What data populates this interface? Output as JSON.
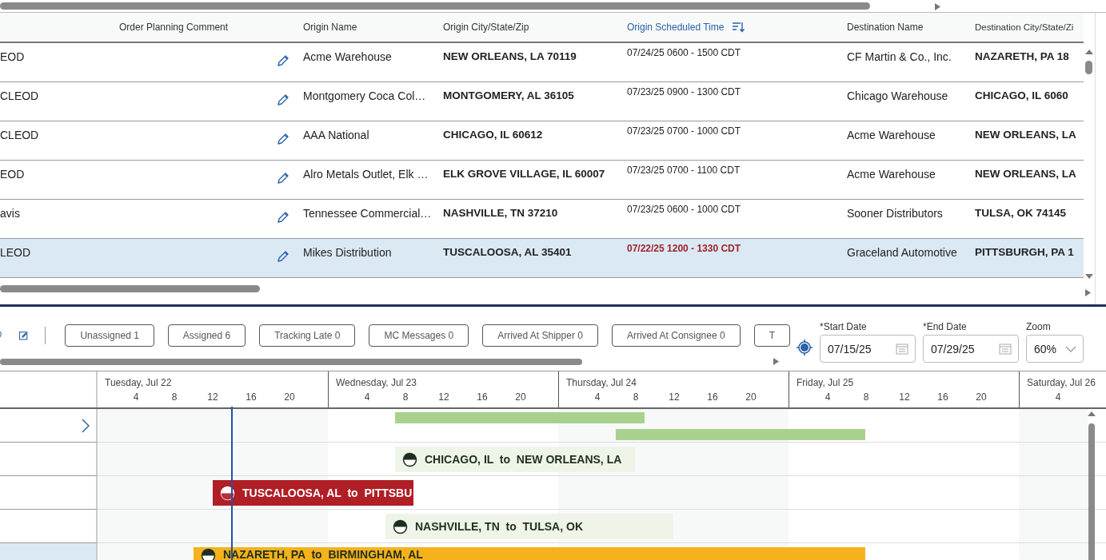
{
  "table": {
    "columns": [
      {
        "label": "Order Planning Comment",
        "sorted": false
      },
      {
        "label": "Origin Name",
        "sorted": false
      },
      {
        "label": "Origin City/State/Zip",
        "sorted": false
      },
      {
        "label": "Origin Scheduled Time",
        "sorted": true
      },
      {
        "label": "Destination Name",
        "sorted": false
      },
      {
        "label": "Destination City/State/Zi",
        "sorted": false
      }
    ],
    "rows": [
      {
        "column_1": "EOD",
        "origin_name": "Acme Warehouse",
        "origin_city": "NEW ORLEANS, LA 70119",
        "origin_time": "07/24/25 0600 - 1500 CDT",
        "late": false,
        "destination_name": "CF Martin & Co., Inc.",
        "destination_city": "NAZARETH, PA 18",
        "selected": false
      },
      {
        "column_1": "CLEOD",
        "origin_name": "Montgomery Coca Col…",
        "origin_city": "MONTGOMERY, AL 36105",
        "origin_time": "07/23/25 0900 - 1300 CDT",
        "late": false,
        "destination_name": "Chicago Warehouse",
        "destination_city": "CHICAGO, IL 6060",
        "selected": false
      },
      {
        "column_1": "CLEOD",
        "origin_name": "AAA National",
        "origin_city": "CHICAGO, IL 60612",
        "origin_time": "07/23/25 0700 - 1000 CDT",
        "late": false,
        "destination_name": "Acme Warehouse",
        "destination_city": "NEW ORLEANS, LA",
        "selected": false
      },
      {
        "column_1": "EOD",
        "origin_name": "Alro Metals Outlet, Elk …",
        "origin_city": "ELK GROVE VILLAGE, IL 60007",
        "origin_time": "07/23/25 0700 - 1100 CDT",
        "late": false,
        "destination_name": "Acme Warehouse",
        "destination_city": "NEW ORLEANS, LA",
        "selected": false
      },
      {
        "column_1": "avis",
        "origin_name": "Tennessee Commercial…",
        "origin_city": "NASHVILLE, TN 37210",
        "origin_time": "07/23/25 0600 - 1000 CDT",
        "late": false,
        "destination_name": "Sooner Distributors",
        "destination_city": "TULSA, OK 74145",
        "selected": false
      },
      {
        "column_1": "LEOD",
        "origin_name": "Mikes Distribution",
        "origin_city": "TUSCALOOSA, AL 35401",
        "origin_time": "07/22/25 1200 - 1330 CDT",
        "late": true,
        "destination_name": "Graceland Automotive",
        "destination_city": "PITTSBURGH, PA 1",
        "selected": true
      }
    ]
  },
  "toolbar": {
    "filters": [
      {
        "label": "Unassigned 1"
      },
      {
        "label": "Assigned 6"
      },
      {
        "label": "Tracking Late 0"
      },
      {
        "label": "MC Messages 0"
      },
      {
        "label": "Arrived At Shipper 0"
      },
      {
        "label": "Arrived At Consignee 0"
      },
      {
        "label": "T"
      }
    ],
    "start_date": {
      "label": "*Start Date",
      "value": "07/15/25"
    },
    "end_date": {
      "label": "*End Date",
      "value": "07/29/25"
    },
    "zoom": {
      "label": "Zoom",
      "value": "60%"
    }
  },
  "gantt": {
    "days": [
      {
        "label": "Tuesday, Jul 22",
        "hours": [
          "4",
          "8",
          "12",
          "16",
          "20"
        ]
      },
      {
        "label": "Wednesday, Jul 23",
        "hours": [
          "4",
          "8",
          "12",
          "16",
          "20"
        ]
      },
      {
        "label": "Thursday, Jul 24",
        "hours": [
          "4",
          "8",
          "12",
          "16",
          "20"
        ]
      },
      {
        "label": "Friday, Jul 25",
        "hours": [
          "4",
          "8",
          "12",
          "16",
          "20"
        ]
      },
      {
        "label": "Saturday, Jul 26",
        "hours": [
          "4"
        ]
      }
    ],
    "rows": [
      {
        "selected": false,
        "expandable": true,
        "bars": [
          {
            "kind": "track",
            "color": "#a9d18e"
          },
          {
            "kind": "track",
            "color": "#a9d18e"
          }
        ]
      },
      {
        "selected": false,
        "expandable": false,
        "bars": [
          {
            "kind": "load",
            "color": "#eef4e7",
            "label": "CHICAGO, IL  to  NEW ORLEANS, LA"
          }
        ]
      },
      {
        "selected": false,
        "expandable": false,
        "bars": [
          {
            "kind": "load",
            "color": "#b01e26",
            "label": "TUSCALOOSA, AL  to  PITTSBU"
          }
        ]
      },
      {
        "selected": false,
        "expandable": false,
        "bars": [
          {
            "kind": "load",
            "color": "#eef4e7",
            "label": "NASHVILLE, TN  to  TULSA, OK"
          }
        ]
      },
      {
        "selected": true,
        "expandable": false,
        "bars": [
          {
            "kind": "load",
            "color": "#f5b21c",
            "label": "NAZARETH, PA  to  BIRMINGHAM, AL"
          }
        ]
      }
    ]
  }
}
